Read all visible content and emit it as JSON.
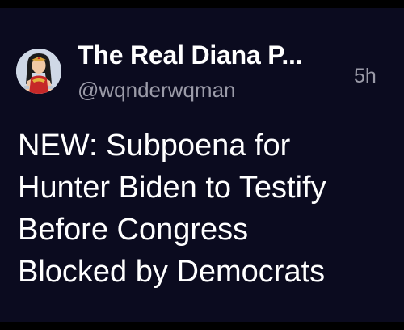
{
  "author": {
    "display_name": "The Real Diana P...",
    "handle": "@wqnderwqman",
    "avatar_icon": "wonder-woman-avatar-icon"
  },
  "post": {
    "timestamp": "5h",
    "text_lines": [
      "NEW: Subpoena for",
      "Hunter Biden to Testify",
      "Before Congress",
      "Blocked by Democrats"
    ]
  },
  "colors": {
    "page_background": "#000000",
    "card_background": "#0b0b1f",
    "primary_text": "#ffffff",
    "secondary_text": "#9b9ba8"
  }
}
